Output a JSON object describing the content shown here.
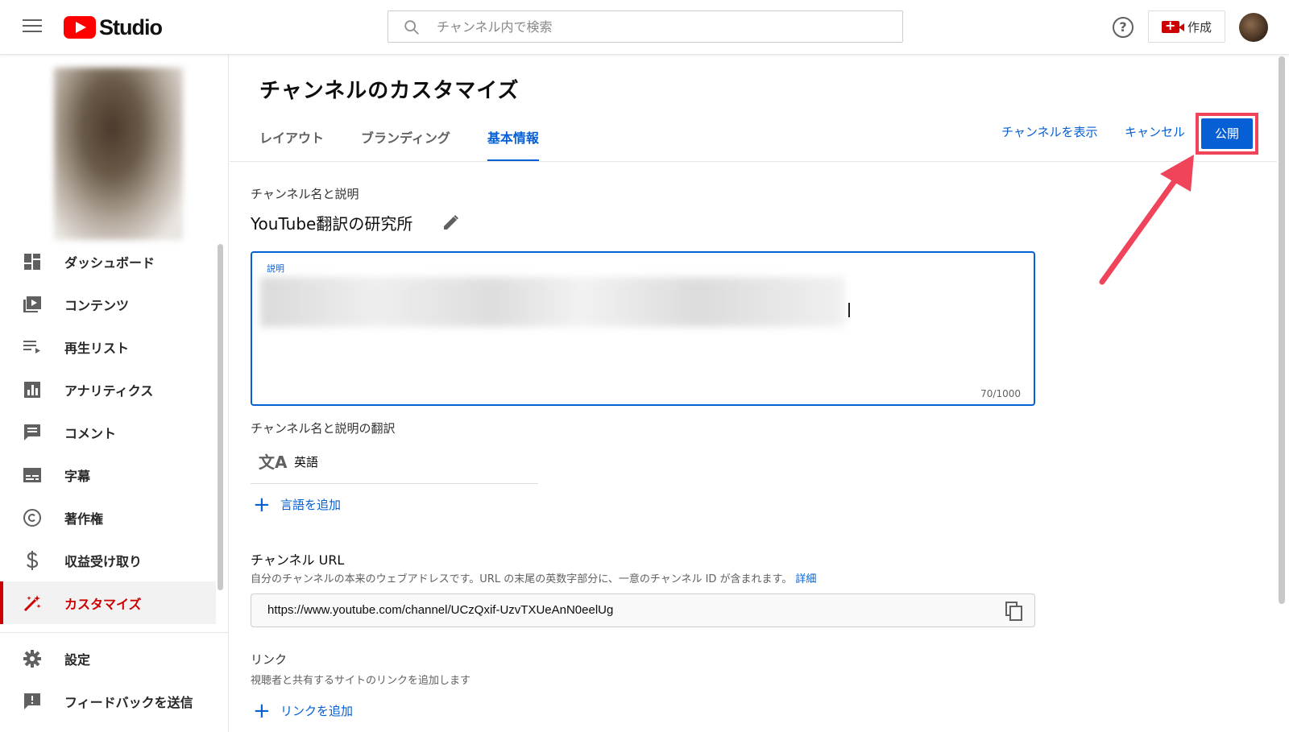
{
  "topbar": {
    "logo_text": "Studio",
    "search_placeholder": "チャンネル内で検索",
    "help_symbol": "?",
    "create_label": "作成"
  },
  "sidebar": {
    "items": [
      {
        "label": "ダッシュボード",
        "icon": "dashboard-icon"
      },
      {
        "label": "コンテンツ",
        "icon": "content-icon"
      },
      {
        "label": "再生リスト",
        "icon": "playlist-icon"
      },
      {
        "label": "アナリティクス",
        "icon": "analytics-icon"
      },
      {
        "label": "コメント",
        "icon": "comment-icon"
      },
      {
        "label": "字幕",
        "icon": "subtitles-icon"
      },
      {
        "label": "著作権",
        "icon": "copyright-icon"
      },
      {
        "label": "収益受け取り",
        "icon": "dollar-icon"
      },
      {
        "label": "カスタマイズ",
        "icon": "magic-wand-icon",
        "active": true
      }
    ],
    "bottom_items": [
      {
        "label": "設定",
        "icon": "gear-icon"
      },
      {
        "label": "フィードバックを送信",
        "icon": "feedback-icon"
      }
    ]
  },
  "main": {
    "title": "チャンネルのカスタマイズ",
    "tabs": [
      {
        "label": "レイアウト"
      },
      {
        "label": "ブランディング"
      },
      {
        "label": "基本情報",
        "active": true
      }
    ],
    "view_channel": "チャンネルを表示",
    "cancel": "キャンセル",
    "publish": "公開",
    "name_section_label": "チャンネル名と説明",
    "channel_name": "YouTube翻訳の研究所",
    "description_label": "説明",
    "description_count": "70/1000",
    "translation_section_label": "チャンネル名と説明の翻訳",
    "translation_icon": "文A",
    "translation_language": "英語",
    "add_language": "言語を追加",
    "url_section_label": "チャンネル URL",
    "url_description": "自分のチャンネルの本来のウェブアドレスです。URL の末尾の英数字部分に、一意のチャンネル ID が含まれます。",
    "url_more": "詳細",
    "channel_url": "https://www.youtube.com/channel/UCzQxif-UzvTXUeAnN0eelUg",
    "links_section_label": "リンク",
    "links_description": "視聴者と共有するサイトのリンクを追加します",
    "add_link": "リンクを追加"
  },
  "colors": {
    "accent_blue": "#065fd4",
    "brand_red": "#ff0000",
    "active_red": "#cc0000",
    "highlight_annotation": "#f0445a"
  }
}
